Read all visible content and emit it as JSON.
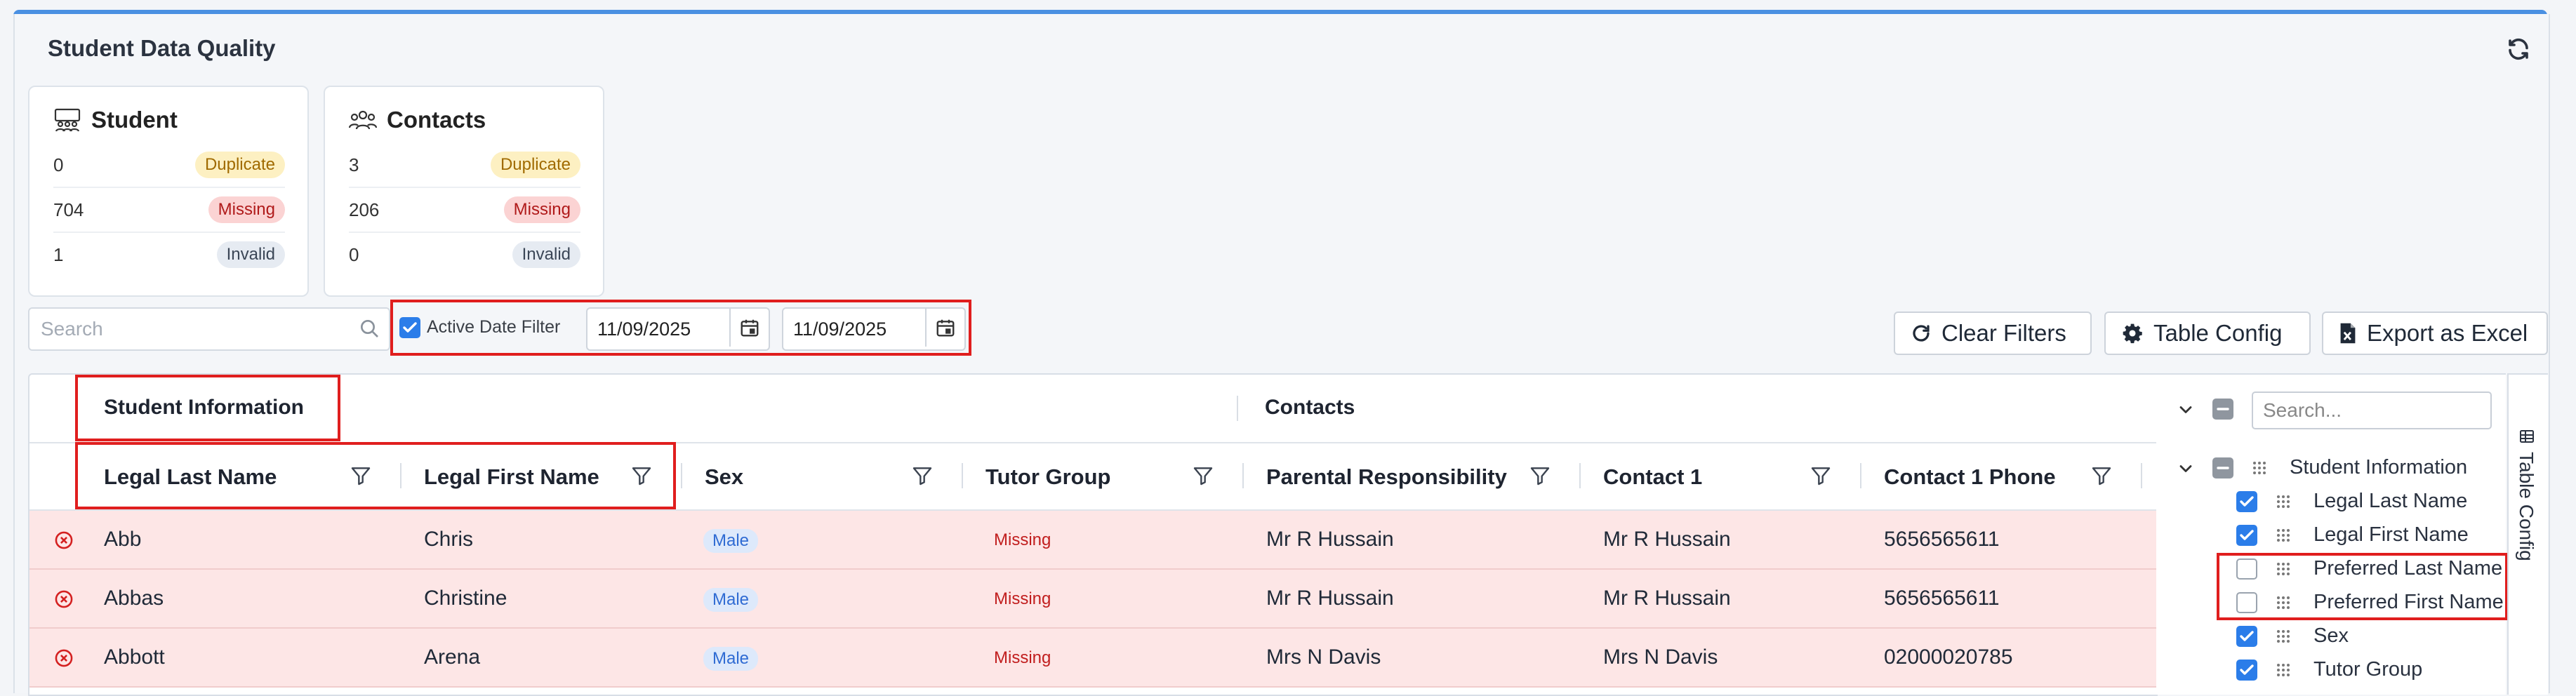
{
  "page": {
    "title": "Student Data Quality"
  },
  "cards": {
    "student": {
      "title": "Student",
      "rows": [
        {
          "count": "0",
          "badge": "Duplicate"
        },
        {
          "count": "704",
          "badge": "Missing"
        },
        {
          "count": "1",
          "badge": "Invalid"
        }
      ]
    },
    "contacts": {
      "title": "Contacts",
      "rows": [
        {
          "count": "3",
          "badge": "Duplicate"
        },
        {
          "count": "206",
          "badge": "Missing"
        },
        {
          "count": "0",
          "badge": "Invalid"
        }
      ]
    }
  },
  "filters": {
    "search_placeholder": "Search",
    "active_date_label": "Active Date Filter",
    "active_date_checked": true,
    "date_from": "11/09/2025",
    "date_to": "11/09/2025"
  },
  "toolbar": {
    "clear_filters": "Clear Filters",
    "table_config": "Table Config",
    "export_excel": "Export as Excel"
  },
  "grid": {
    "groups": [
      "Student Information",
      "Contacts"
    ],
    "columns": [
      "Legal Last Name",
      "Legal First Name",
      "Sex",
      "Tutor Group",
      "Parental Responsibility",
      "Contact 1",
      "Contact 1 Phone"
    ],
    "rows": [
      {
        "last": "Abb",
        "first": "Chris",
        "sex": "Male",
        "tutor": "Missing",
        "parental": "Mr R Hussain",
        "contact1": "Mr R Hussain",
        "phone": "5656565611"
      },
      {
        "last": "Abbas",
        "first": "Christine",
        "sex": "Male",
        "tutor": "Missing",
        "parental": "Mr R Hussain",
        "contact1": "Mr R Hussain",
        "phone": "5656565611"
      },
      {
        "last": "Abbott",
        "first": "Arena",
        "sex": "Male",
        "tutor": "Missing",
        "parental": "Mrs N Davis",
        "contact1": "Mrs N Davis",
        "phone": "02000020785"
      }
    ]
  },
  "config_panel": {
    "search_placeholder": "Search...",
    "group": "Student Information",
    "items": [
      {
        "label": "Legal Last Name",
        "checked": true
      },
      {
        "label": "Legal First Name",
        "checked": true
      },
      {
        "label": "Preferred Last Name",
        "checked": false
      },
      {
        "label": "Preferred First Name",
        "checked": false
      },
      {
        "label": "Sex",
        "checked": true
      },
      {
        "label": "Tutor Group",
        "checked": true
      }
    ],
    "side_tab_label": "Table Config"
  },
  "colors": {
    "accent": "#2b7de9",
    "row_error_bg": "#fde6e6",
    "highlight": "#e01e1e"
  }
}
